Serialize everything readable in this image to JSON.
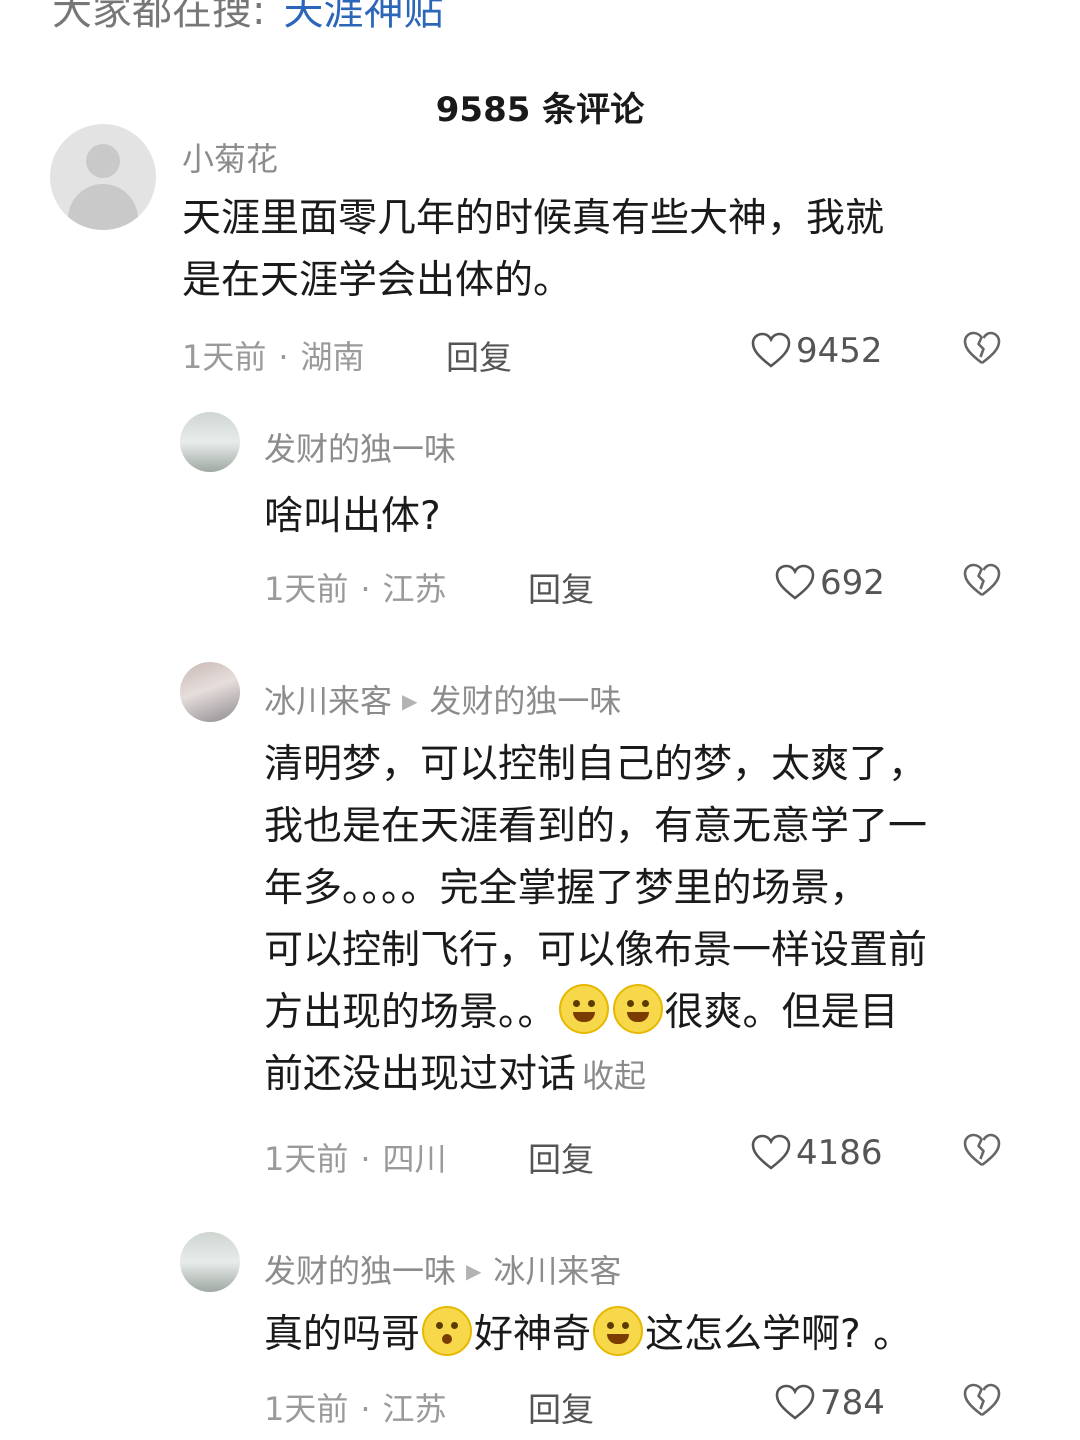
{
  "search": {
    "prefix": "大家都在搜:",
    "term": "天涯神贴"
  },
  "comments_count": "9585 条评论",
  "comments": [
    {
      "user": "小菊花",
      "text_lines": [
        "天涯里面零几年的时候真有些大神，我就",
        "是在天涯学会出体的。"
      ],
      "time": "1天前",
      "location": "湖南",
      "reply_label": "回复",
      "likes": "9452"
    },
    {
      "user": "发财的独一味",
      "text_lines": [
        "啥叫出体?"
      ],
      "time": "1天前",
      "location": "江苏",
      "reply_label": "回复",
      "likes": "692"
    },
    {
      "user": "冰川来客",
      "reply_to": "发财的独一味",
      "text_lines": [
        "清明梦，可以控制自己的梦，太爽了，",
        "我也是在天涯看到的，有意无意学了一",
        "年多。。。。完全掌握了梦里的场景，",
        "可以控制飞行，可以像布景一样设置前",
        "方出现的场景。。",
        "很爽。但是目",
        "前还没出现过对话"
      ],
      "collapse_label": "收起",
      "time": "1天前",
      "location": "四川",
      "reply_label": "回复",
      "likes": "4186"
    },
    {
      "user": "发财的独一味",
      "reply_to": "冰川来客",
      "text_parts": [
        "真的吗哥",
        "好神奇",
        "这怎么学啊? 。"
      ],
      "time": "1天前",
      "location": "江苏",
      "reply_label": "回复",
      "likes": "784"
    }
  ],
  "icons": [
    "heart-outline-icon",
    "broken-heart-icon",
    "grin-emoji-icon",
    "pleading-emoji-icon",
    "smile-emoji-icon",
    "triangle-arrow-icon",
    "default-avatar-icon"
  ]
}
